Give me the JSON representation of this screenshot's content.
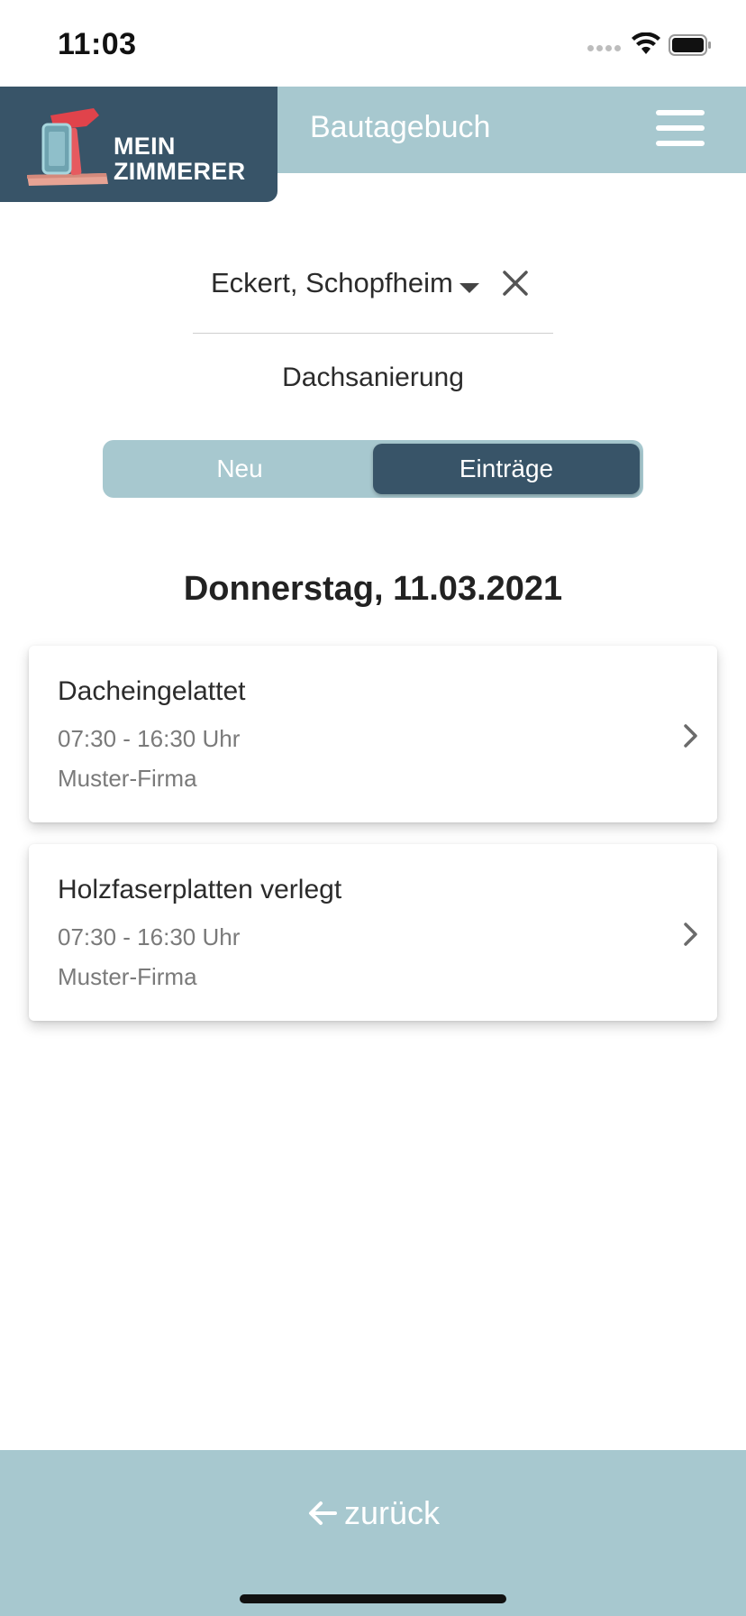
{
  "status_bar": {
    "time": "11:03"
  },
  "header": {
    "logo_line1": "MEIN",
    "logo_line2": "ZIMMERER",
    "title": "Bautagebuch"
  },
  "project": {
    "selected": "Eckert, Schopfheim",
    "subproject": "Dachsanierung"
  },
  "tabs": [
    {
      "label": "Neu",
      "active": false
    },
    {
      "label": "Einträge",
      "active": true
    }
  ],
  "date_heading": "Donnerstag, 11.03.2021",
  "entries": [
    {
      "title": "Dacheingelattet",
      "time": "07:30 - 16:30 Uhr",
      "company": "Muster-Firma"
    },
    {
      "title": "Holzfaserplatten verlegt",
      "time": "07:30 - 16:30 Uhr",
      "company": "Muster-Firma"
    }
  ],
  "footer": {
    "back_label": "zurück"
  },
  "colors": {
    "accent_light": "#a7c8cf",
    "accent_dark": "#385468"
  }
}
